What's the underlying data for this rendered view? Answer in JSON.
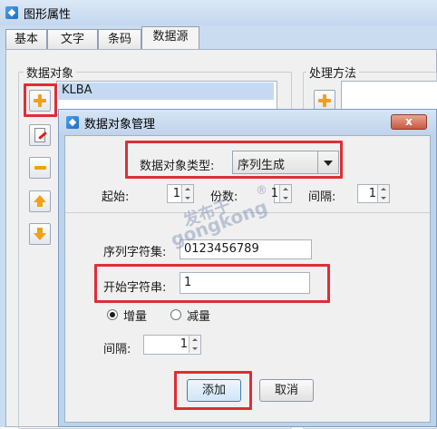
{
  "back_window": {
    "title": "图形属性",
    "tabs": [
      "基本",
      "文字",
      "条码",
      "数据源"
    ],
    "active_tab": "数据源",
    "data_objects_group": "数据对象",
    "processing_group": "处理方法",
    "data_objects": [
      "KLBA"
    ]
  },
  "dialog": {
    "title": "数据对象管理",
    "close_symbol": "x",
    "type_label": "数据对象类型:",
    "type_value": "序列生成",
    "start_label": "起始:",
    "start_value": "1",
    "copies_label": "份数:",
    "copies_value": "1",
    "interval_label": "间隔:",
    "interval_value": "1",
    "charset_label": "序列字符集:",
    "charset_value": "0123456789",
    "start_string_label": "开始字符串:",
    "start_string_value": "1",
    "increment_label": "增量",
    "decrement_label": "减量",
    "selected_mode": "增量",
    "step_label": "间隔:",
    "step_value": "1",
    "add_button": "添加",
    "cancel_button": "取消"
  },
  "watermark": {
    "line1": "发布于",
    "line2": "gongkong",
    "mark": "®"
  },
  "colors": {
    "highlight": "#dc2f36",
    "accent_icon": "#f0a214",
    "window_frame": "#c9dcf0"
  }
}
